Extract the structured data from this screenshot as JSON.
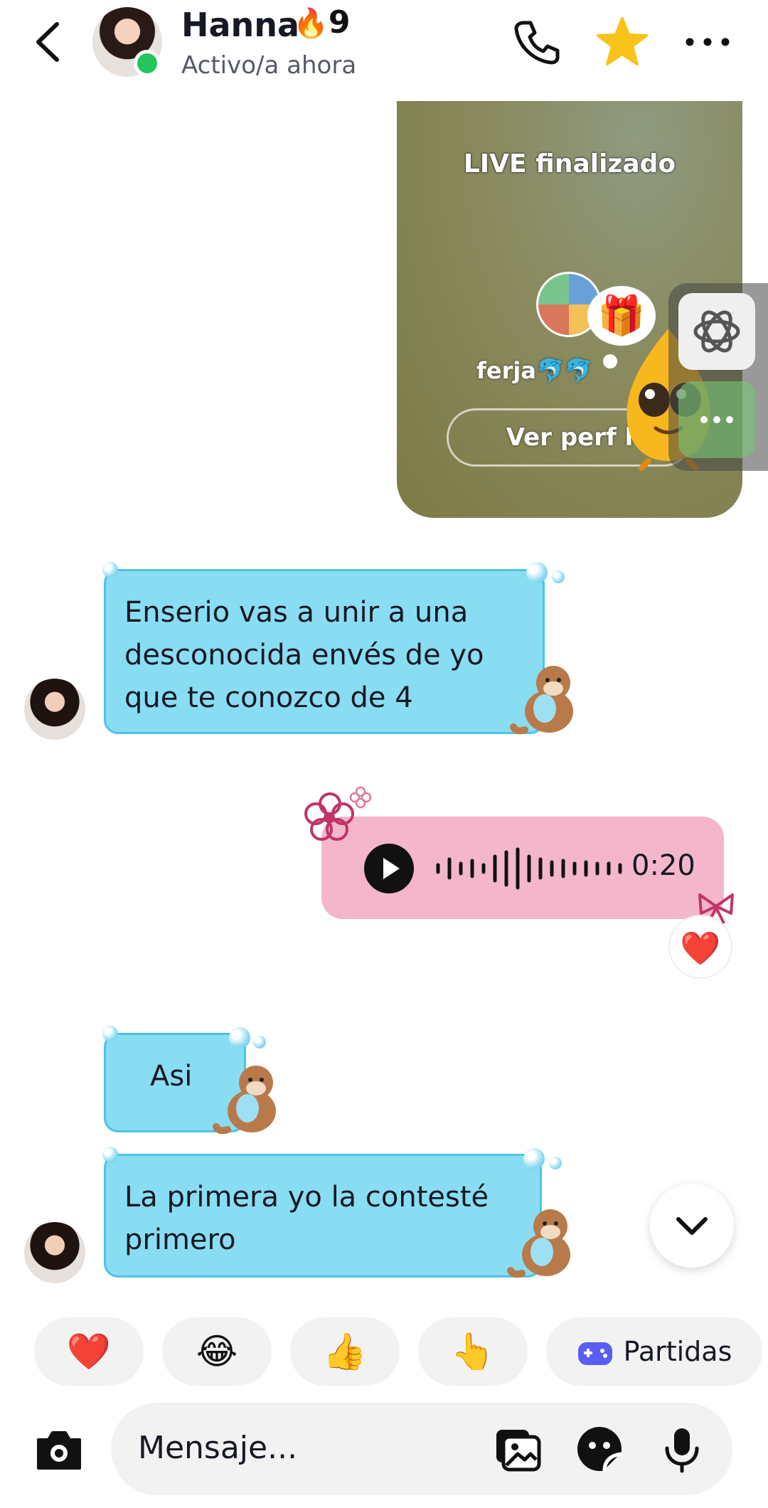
{
  "header": {
    "name": "Hanna",
    "streak_icon": "flame-icon",
    "streak_count": "9",
    "status": "Activo/a ahora",
    "colors": {
      "online": "#22c55e",
      "star": "#f8c31a"
    }
  },
  "live_card": {
    "title": "LIVE finalizado",
    "username": "ferja🐬🐬",
    "button": "Ver perf l"
  },
  "messages": {
    "m1": "Enserio vas a unir a una desconocida envés de yo que te conozco de 4",
    "voice_duration": "0:20",
    "voice_reaction": "❤️",
    "m2": "Asi",
    "m3": "La primera yo la contesté primero"
  },
  "quick_reactions": [
    "❤️",
    "😂",
    "👍",
    "👆"
  ],
  "games_chip": "Partidas",
  "composer": {
    "placeholder": "Mensaje..."
  },
  "colors": {
    "incoming_bubble": "#89ddf2",
    "voice_bubble": "#f4b6cb"
  }
}
